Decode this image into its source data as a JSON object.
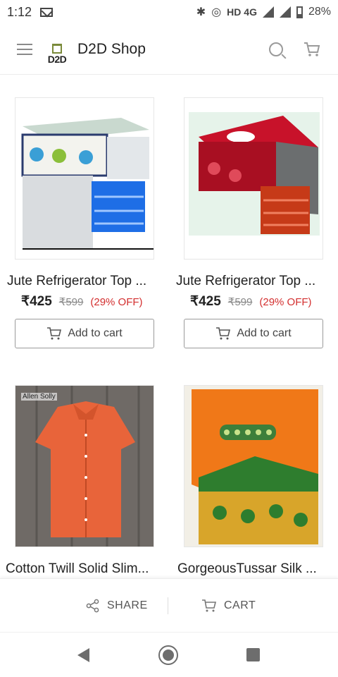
{
  "status_bar": {
    "time": "1:12",
    "network": "HD 4G",
    "battery": "28%"
  },
  "header": {
    "logo_text": "D2D",
    "title": "D2D Shop"
  },
  "products": [
    {
      "name": "Jute Refrigerator Top ...",
      "price": "₹425",
      "mrp": "₹599",
      "discount": "(29% OFF)",
      "add_label": "Add to cart"
    },
    {
      "name": "Jute Refrigerator Top ...",
      "price": "₹425",
      "mrp": "₹599",
      "discount": "(29% OFF)",
      "add_label": "Add to cart"
    },
    {
      "name": "Cotton Twill Solid Slim...",
      "brand_tag": "Allen Solly"
    },
    {
      "name": "GorgeousTussar Silk ..."
    }
  ],
  "action_bar": {
    "share_label": "SHARE",
    "cart_label": "CART"
  },
  "colors": {
    "discount": "#d32f2f",
    "border": "#9a9a9a"
  }
}
